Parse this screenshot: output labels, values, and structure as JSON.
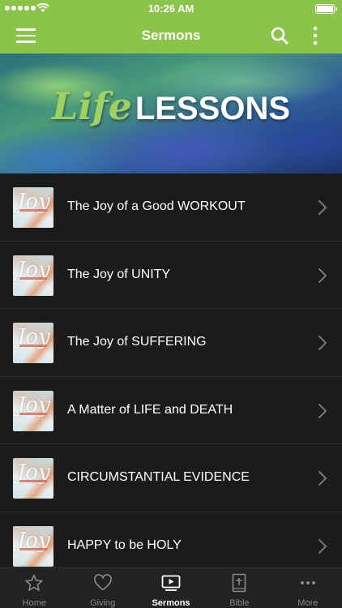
{
  "status_bar": {
    "time": "10:26 AM"
  },
  "header": {
    "title": "Sermons"
  },
  "banner": {
    "script_word": "Life",
    "bold_word": "LESSONS"
  },
  "sermons": [
    {
      "title": "The Joy of a Good WORKOUT",
      "thumb_text": "Joy"
    },
    {
      "title": "The Joy of UNITY",
      "thumb_text": "Joy"
    },
    {
      "title": "The Joy of SUFFERING",
      "thumb_text": "Joy"
    },
    {
      "title": "A Matter of LIFE and DEATH",
      "thumb_text": "Joy"
    },
    {
      "title": "CIRCUMSTANTIAL EVIDENCE",
      "thumb_text": "Joy"
    },
    {
      "title": "HAPPY to be HOLY",
      "thumb_text": "Joy"
    }
  ],
  "tabs": [
    {
      "label": "Home",
      "icon": "star-icon"
    },
    {
      "label": "Giving",
      "icon": "heart-icon"
    },
    {
      "label": "Sermons",
      "icon": "play-icon",
      "active": true
    },
    {
      "label": "Bible",
      "icon": "bible-icon"
    },
    {
      "label": "More",
      "icon": "ellipsis-icon"
    }
  ],
  "colors": {
    "accent": "#8cc34a",
    "list_bg": "#1b1b1b",
    "tab_bar_bg": "#222222"
  }
}
